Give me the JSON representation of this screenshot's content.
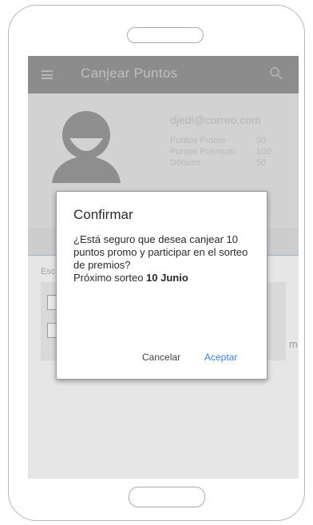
{
  "app": {
    "title": "Canjear Puntos"
  },
  "profile": {
    "email": "djedi@correo.com",
    "stats": [
      {
        "label": "Puntos Promo",
        "value": "50"
      },
      {
        "label": "Puntos Premium",
        "value": "100"
      },
      {
        "label": "Dólares",
        "value": "50"
      }
    ]
  },
  "background": {
    "section_text": "Esc",
    "trailing_text": "m"
  },
  "dialog": {
    "title": "Confirmar",
    "message_line1": "¿Está seguro que desea canjear 10 puntos promo y participar en el sorteo de premios?",
    "next_draw_prefix": "Próximo sorteo ",
    "next_draw_date": "10 Junio",
    "cancel_label": "Cancelar",
    "accept_label": "Aceptar"
  },
  "colors": {
    "accent": "#3a7fd1",
    "appbar": "#8c8c8c",
    "scrim_background": "#e6e6e6"
  },
  "icons": [
    "menu-icon",
    "search-icon",
    "avatar-icon"
  ]
}
